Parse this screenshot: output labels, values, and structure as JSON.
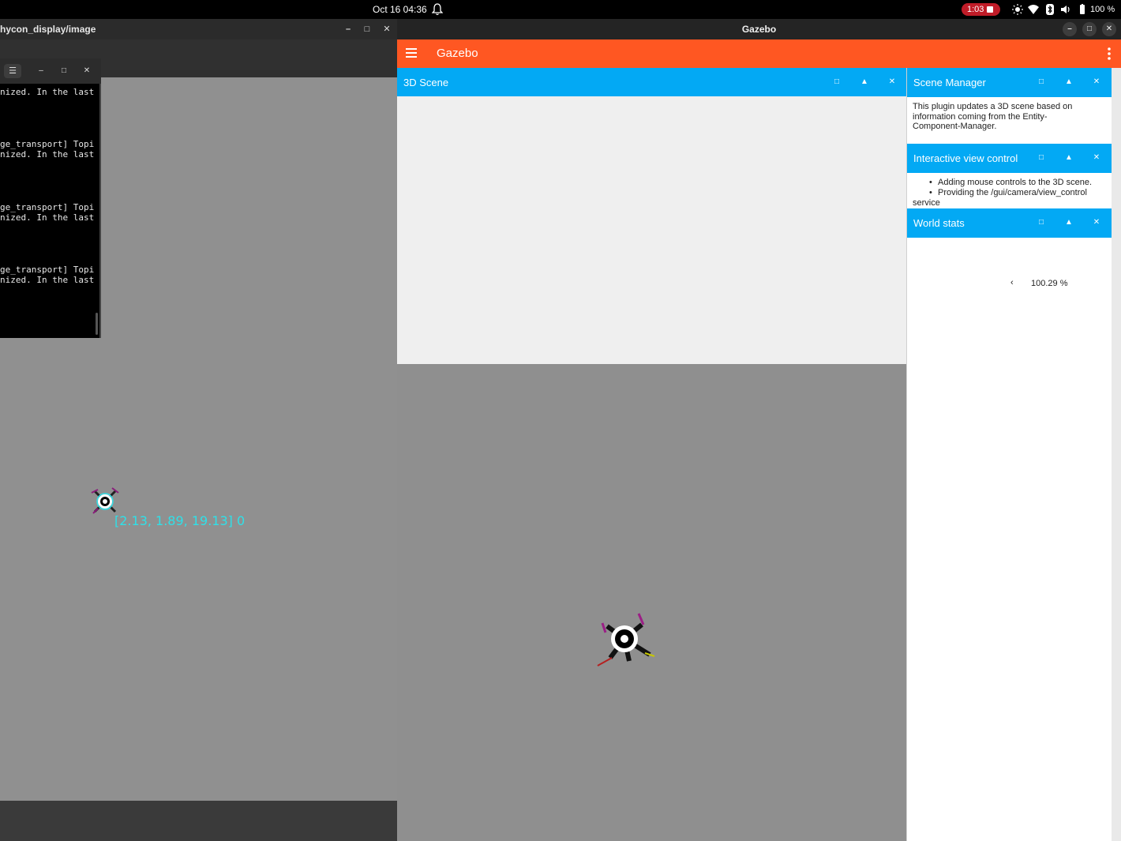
{
  "system_bar": {
    "datetime": "Oct 16  04:36",
    "recording_time": "1:03",
    "battery": "100 %"
  },
  "left_window": {
    "title": "hycon_display/image",
    "terminal": {
      "lines": [
        "nized. In the last",
        "ge_transport] Topi",
        "nized. In the last",
        "ge_transport] Topi",
        "nized. In the last",
        "ge_transport] Topi",
        "nized. In the last"
      ]
    },
    "drone_label": "[2.13, 1.89, 19.13] 0"
  },
  "gazebo": {
    "window_title": "Gazebo",
    "app_title": "Gazebo",
    "scene_panel": {
      "title": "3D Scene"
    },
    "scene_manager": {
      "title": "Scene Manager",
      "description": "This plugin updates a 3D scene based on information coming from the Entity-Component-Manager."
    },
    "view_control": {
      "title": "Interactive view control",
      "bullets": [
        "Adding mouse controls to the 3D scene.",
        "Providing the /gui/camera/view_control"
      ],
      "continuation": "service"
    },
    "world_stats": {
      "title": "World stats",
      "real_time_factor": "100.29 %"
    }
  },
  "colors": {
    "appbar": "#ff5722",
    "panel_header": "#03a9f4",
    "drone_label": "#2fe0e8"
  },
  "icons": [
    "bell-icon",
    "brightness-icon",
    "wifi-icon",
    "bluetooth-icon",
    "volume-icon",
    "battery-icon",
    "hamburger-icon",
    "kebab-icon"
  ]
}
